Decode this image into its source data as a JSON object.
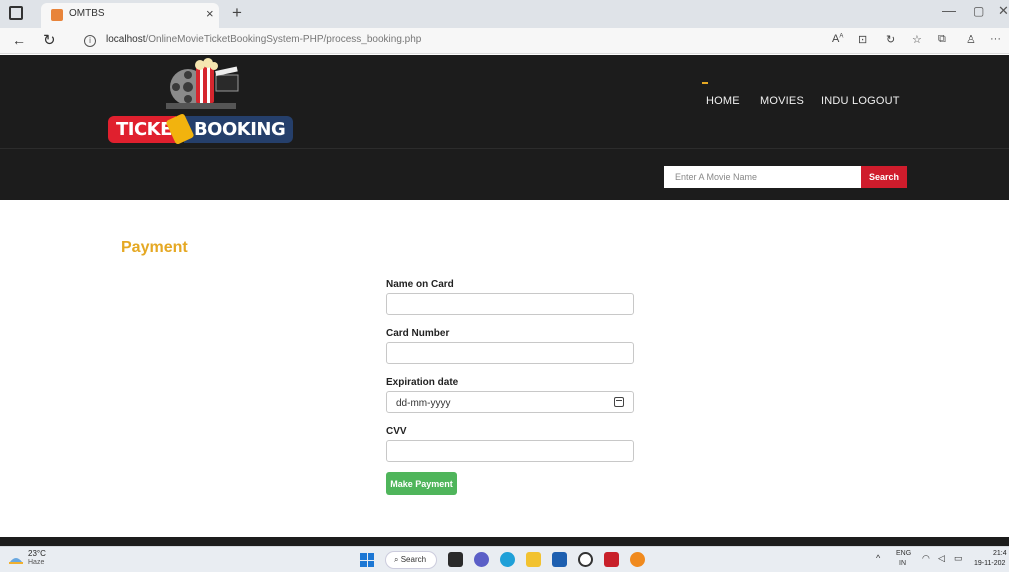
{
  "browser": {
    "tab_title": "OMTBS",
    "tab_close": "×",
    "new_tab": "+",
    "url_host": "localhost",
    "url_path": "/OnlineMovieTicketBookingSystem-PHP/process_booking.php",
    "window_controls": {
      "minimize": "—",
      "maximize": "▢",
      "close": "✕"
    }
  },
  "site": {
    "logo": {
      "text_left": "TICKE",
      "text_right": "BOOKING"
    },
    "nav": [
      {
        "label": "HOME",
        "active": true
      },
      {
        "label": "MOVIES"
      },
      {
        "label": "INDU"
      },
      {
        "label": "LOGOUT"
      }
    ],
    "search": {
      "placeholder": "Enter A Movie Name",
      "button_label": "Search"
    }
  },
  "payment": {
    "title": "Payment",
    "fields": [
      {
        "label": "Name on Card",
        "value": ""
      },
      {
        "label": "Card Number",
        "value": ""
      },
      {
        "label": "Expiration date",
        "value": "dd-mm-yyyy"
      },
      {
        "label": "CVV",
        "value": ""
      }
    ],
    "submit_label": "Make Payment"
  },
  "taskbar": {
    "weather": {
      "temp": "23°C",
      "desc": "Haze"
    },
    "search_label": "Search",
    "lang_top": "ENG",
    "lang_bottom": "IN",
    "time": "21:4",
    "date": "19-11-202"
  },
  "colors": {
    "accent_gold": "#e5a823",
    "search_red": "#cf1c2c",
    "pay_green": "#4fb55b",
    "header_dark": "#1c1c1c"
  }
}
